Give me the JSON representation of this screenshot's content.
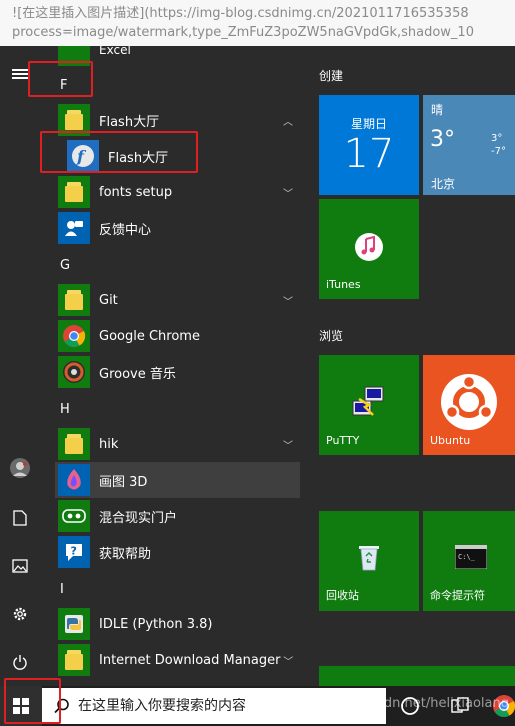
{
  "browser_strip": {
    "line1": "![在这里插入图片描述](https://img-blog.csdnimg.cn/2021011716535358",
    "line2": "process=image/watermark,type_ZmFuZ3poZW5naGVpdGk,shadow_10"
  },
  "app_list": {
    "partial_top_item": "Excel",
    "groups": [
      {
        "letter": "F",
        "items": [
          {
            "label": "Flash大厅",
            "icon": "folder-icon",
            "chevron": "up"
          },
          {
            "label": "Flash大厅",
            "icon": "flash-icon"
          },
          {
            "label": "fonts setup",
            "icon": "folder-icon",
            "chevron": "down"
          },
          {
            "label": "反馈中心",
            "icon": "feedback-icon"
          }
        ]
      },
      {
        "letter": "G",
        "items": [
          {
            "label": "Git",
            "icon": "folder-icon",
            "chevron": "down"
          },
          {
            "label": "Google Chrome",
            "icon": "chrome-icon"
          },
          {
            "label": "Groove 音乐",
            "icon": "groove-icon"
          }
        ]
      },
      {
        "letter": "H",
        "items": [
          {
            "label": "hik",
            "icon": "folder-icon",
            "chevron": "down"
          },
          {
            "label": "画图 3D",
            "icon": "paint3d-icon"
          },
          {
            "label": "混合现实门户",
            "icon": "mixed-reality-icon"
          },
          {
            "label": "获取帮助",
            "icon": "help-icon"
          }
        ]
      },
      {
        "letter": "I",
        "items": [
          {
            "label": "IDLE (Python 3.8)",
            "icon": "python-icon"
          },
          {
            "label": "Internet Download Manager",
            "icon": "folder-icon",
            "chevron": "down"
          }
        ]
      }
    ]
  },
  "tiles": {
    "section_create": "创建",
    "section_browse": "浏览",
    "calendar": {
      "weekday": "星期日",
      "day": "17"
    },
    "weather": {
      "condition": "晴",
      "temp": "3°",
      "high": "3°",
      "low": "-7°",
      "city": "北京"
    },
    "itunes": "iTunes",
    "putty": "PuTTY",
    "ubuntu": "Ubuntu",
    "recycle": "回收站",
    "cmd": "命令提示符"
  },
  "taskbar": {
    "search_placeholder": "在这里输入你要搜索的内容",
    "watermark": "https://blog.csdn.net/helixiaolang"
  },
  "colors": {
    "accent_blue": "#0063b1",
    "tile_green": "#107c10",
    "ubuntu_orange": "#e95420",
    "annotation_red": "#e02020"
  }
}
